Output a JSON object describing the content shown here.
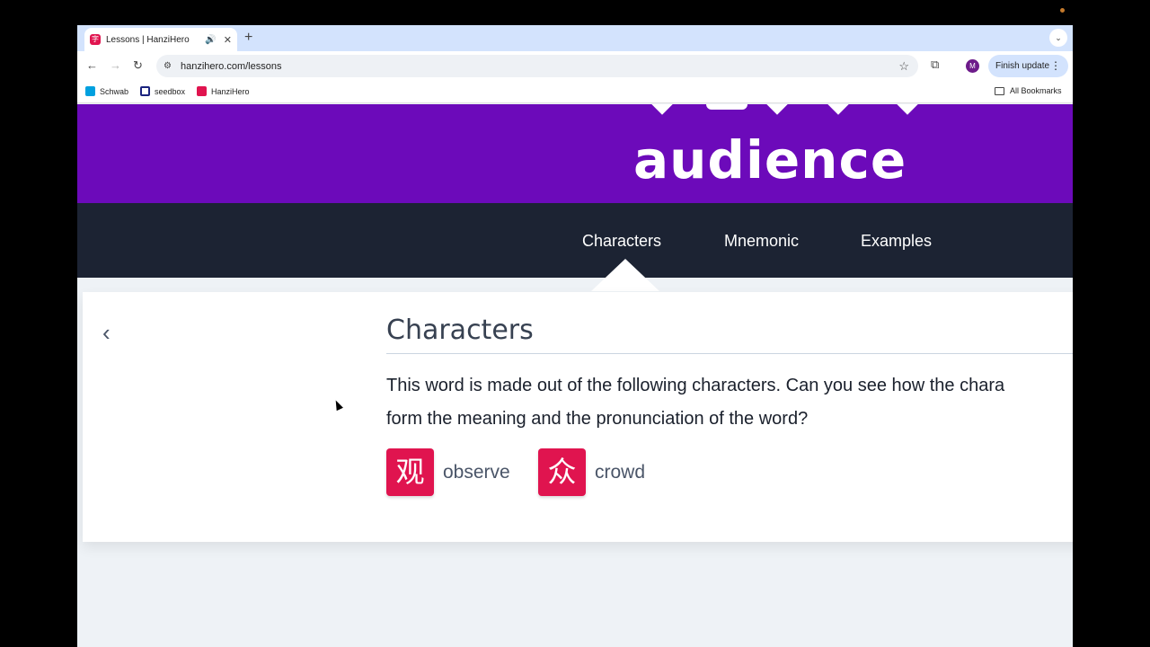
{
  "browser": {
    "tab_title": "Lessons | HanziHero",
    "favicon_glyph": "字",
    "url": "hanzihero.com/lessons",
    "finish_update_label": "Finish update",
    "profile_initial": "M",
    "bookmarks": [
      {
        "label": "Schwab"
      },
      {
        "label": "seedbox"
      },
      {
        "label": "HanziHero"
      }
    ],
    "all_bookmarks_label": "All Bookmarks"
  },
  "hero": {
    "word": "audience"
  },
  "nav_tabs": [
    {
      "label": "Characters",
      "active": true
    },
    {
      "label": "Mnemonic",
      "active": false
    },
    {
      "label": "Examples",
      "active": false
    }
  ],
  "card": {
    "title": "Characters",
    "description_line1": "This word is made out of the following characters. Can you see how the chara",
    "description_line2": "form the meaning and the pronunciation of the word?",
    "characters": [
      {
        "glyph": "观",
        "meaning": "observe"
      },
      {
        "glyph": "众",
        "meaning": "crowd"
      }
    ]
  },
  "colors": {
    "hero_purple": "#6c0aba",
    "nav_dark": "#1c2333",
    "char_tile": "#e0144f"
  }
}
